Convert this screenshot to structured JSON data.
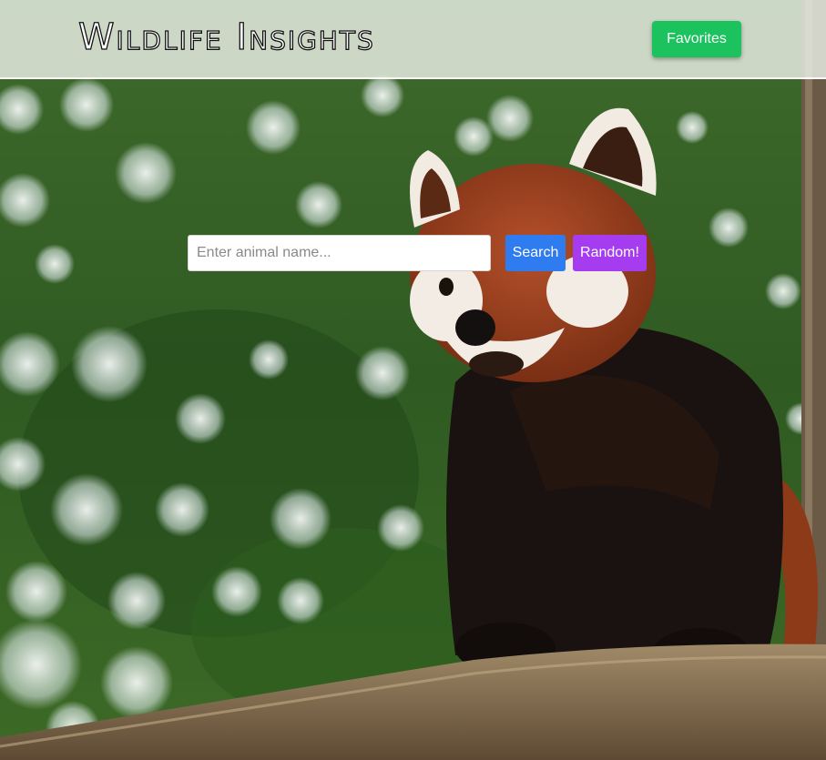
{
  "header": {
    "logo_text": "Wildlife Insights",
    "favorites_label": "Favorites"
  },
  "search": {
    "placeholder": "Enter animal name...",
    "value": "",
    "search_label": "Search",
    "random_label": "Random!"
  },
  "background": {
    "subject": "red-panda-photo"
  },
  "colors": {
    "favorites": "#1bc25d",
    "search": "#2f7cf0",
    "random": "#a53cf0"
  }
}
